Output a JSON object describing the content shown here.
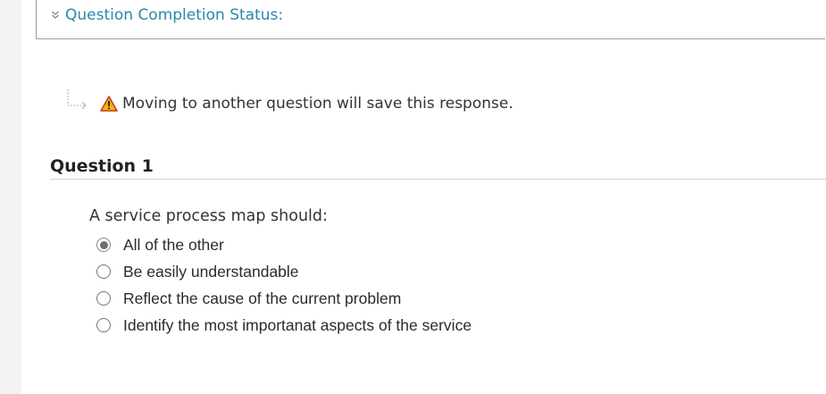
{
  "completion": {
    "label": "Question Completion Status:",
    "toggle_icon": "double-chevron-down-icon"
  },
  "notice": {
    "icon": "warning-icon",
    "text": "Moving to another question will save this response."
  },
  "question": {
    "heading": "Question 1",
    "prompt": "A service process map should:",
    "selected_index": 0,
    "options": [
      {
        "label": "All of the other"
      },
      {
        "label": "Be easily understandable"
      },
      {
        "label": "Reflect the cause of the current problem"
      },
      {
        "label": "Identify the most importanat aspects of the service"
      }
    ]
  },
  "colors": {
    "link": "#2a87a8",
    "warning_fill": "#f4b400",
    "warning_border": "#c0392b"
  }
}
